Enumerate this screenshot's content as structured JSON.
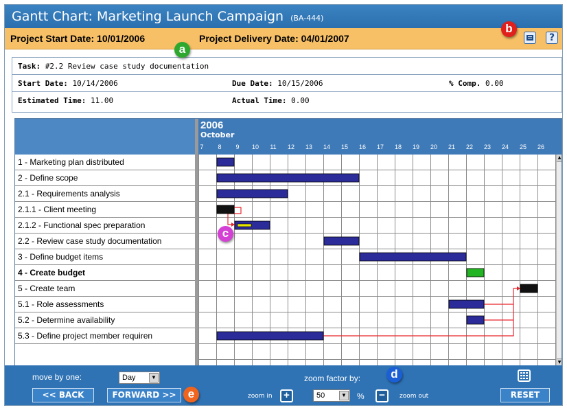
{
  "header": {
    "title": "Gantt Chart: Marketing Launch Campaign",
    "code": "(BA-444)",
    "start_date": "Project Start Date: 10/01/2006",
    "delivery_date": "Project Delivery Date: 04/01/2007",
    "help_label": "?"
  },
  "markers": {
    "a": "a",
    "b": "b",
    "c": "c",
    "d": "d",
    "e": "e"
  },
  "task_info": {
    "task_label": "Task:",
    "task_value": "#2.2 Review case study documentation",
    "start_label": "Start Date:",
    "start_value": "10/14/2006",
    "due_label": "Due Date:",
    "due_value": "10/15/2006",
    "comp_label": "% Comp.",
    "comp_value": "0.00",
    "est_label": "Estimated Time:",
    "est_value": "11.00",
    "actual_label": "Actual Time:",
    "actual_value": "0.00"
  },
  "timeline": {
    "year": "2006",
    "month": "October",
    "days": [
      "7",
      "8",
      "9",
      "10",
      "11",
      "12",
      "13",
      "14",
      "15",
      "16",
      "17",
      "18",
      "19",
      "20",
      "21",
      "22",
      "23",
      "24",
      "25",
      "26"
    ]
  },
  "tasks": [
    {
      "label": "1 - Marketing plan distributed",
      "bold": false,
      "bar": {
        "start": 1,
        "span": 1,
        "color": "#2b2b9a"
      }
    },
    {
      "label": "2 - Define scope",
      "bold": false,
      "bar": {
        "start": 1,
        "span": 8,
        "color": "#2b2b9a"
      }
    },
    {
      "label": "2.1 - Requirements analysis",
      "bold": false,
      "bar": {
        "start": 1,
        "span": 4,
        "color": "#2b2b9a"
      }
    },
    {
      "label": "2.1.1 - Client meeting",
      "bold": false,
      "bar": {
        "start": 1,
        "span": 1,
        "color": "#111111"
      }
    },
    {
      "label": "2.1.2 - Functional spec preparation",
      "bold": false,
      "bar": {
        "start": 2,
        "span": 2,
        "color": "#2b2b9a",
        "progress_color": "#e6e600"
      }
    },
    {
      "label": "2.2 - Review case study documentation",
      "bold": false,
      "bar": {
        "start": 7,
        "span": 2,
        "color": "#2b2b9a"
      }
    },
    {
      "label": "3 - Define budget items",
      "bold": false,
      "bar": {
        "start": 9,
        "span": 6,
        "color": "#2b2b9a"
      }
    },
    {
      "label": "4 - Create budget",
      "bold": true,
      "bar": {
        "start": 15,
        "span": 1,
        "color": "#22b422"
      }
    },
    {
      "label": "5 - Create team",
      "bold": false,
      "bar": {
        "start": 18,
        "span": 1,
        "color": "#111111"
      }
    },
    {
      "label": "5.1 - Role assessments",
      "bold": false,
      "bar": {
        "start": 14,
        "span": 2,
        "color": "#2b2b9a"
      }
    },
    {
      "label": "5.2 - Determine availability",
      "bold": false,
      "bar": {
        "start": 15,
        "span": 1,
        "color": "#2b2b9a"
      }
    },
    {
      "label": "5.3 - Define project member requiren",
      "bold": false,
      "bar": {
        "start": 1,
        "span": 6,
        "color": "#2b2b9a"
      }
    }
  ],
  "footer": {
    "move_label": "move by one:",
    "move_value": "Day",
    "back_label": "<< BACK",
    "forward_label": "FORWARD >>",
    "zoom_factor_label": "zoom factor by:",
    "zoom_in_label": "zoom in",
    "zoom_value": "50",
    "percent": "%",
    "zoom_out_label": "zoom out",
    "reset_label": "RESET"
  },
  "colors": {
    "title_bg": "#2b6fae",
    "date_bar": "#f7c066",
    "dependency_line": "#e8242b",
    "marker_a": "#2ea82e",
    "marker_b": "#e0201c",
    "marker_c": "#d43fd4",
    "marker_d": "#1a5fd6",
    "marker_e": "#f0641e"
  }
}
